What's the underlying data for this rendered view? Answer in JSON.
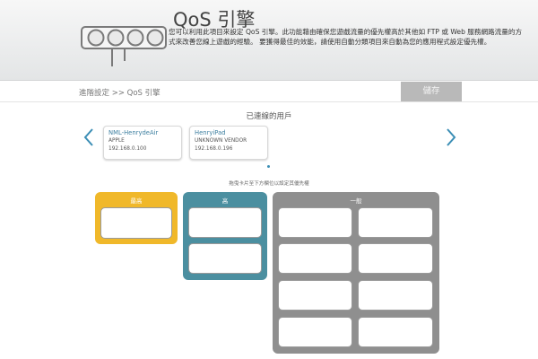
{
  "header": {
    "title": "QoS 引擎",
    "description": "您可以利用此項目來設定 QoS 引擎。此功能藉由確保您遊戲流量的優先權高於其他如 FTP 或 Web 服務網路流量的方式來改善您線上遊戲的經驗。 要獲得最佳的效能，請使用自動分類項目來自動為您的應用程式設定優先權。"
  },
  "navbar": {
    "breadcrumb": "進階設定 >> QoS 引擎",
    "save_label": "儲存"
  },
  "connected": {
    "title": "已連線的用戶",
    "devices": [
      {
        "name": "NML-HenrydeAir",
        "vendor": "APPLE",
        "ip": "192.168.0.100"
      },
      {
        "name": "HenryiPad",
        "vendor": "UNKNOWN VENDOR",
        "ip": "192.168.0.196"
      }
    ]
  },
  "priority": {
    "hint": "拖曳卡片至下方欄位以設定其優先權",
    "highest_label": "最高",
    "high_label": "高",
    "normal_label": "一般"
  },
  "colors": {
    "highest": "#f0b82a",
    "high": "#4b8fa0",
    "normal": "#8f8f8f",
    "accent": "#3b8eb5"
  },
  "icons": {
    "logo": "traffic-light-icon",
    "prev": "chevron-left-icon",
    "next": "chevron-right-icon"
  }
}
